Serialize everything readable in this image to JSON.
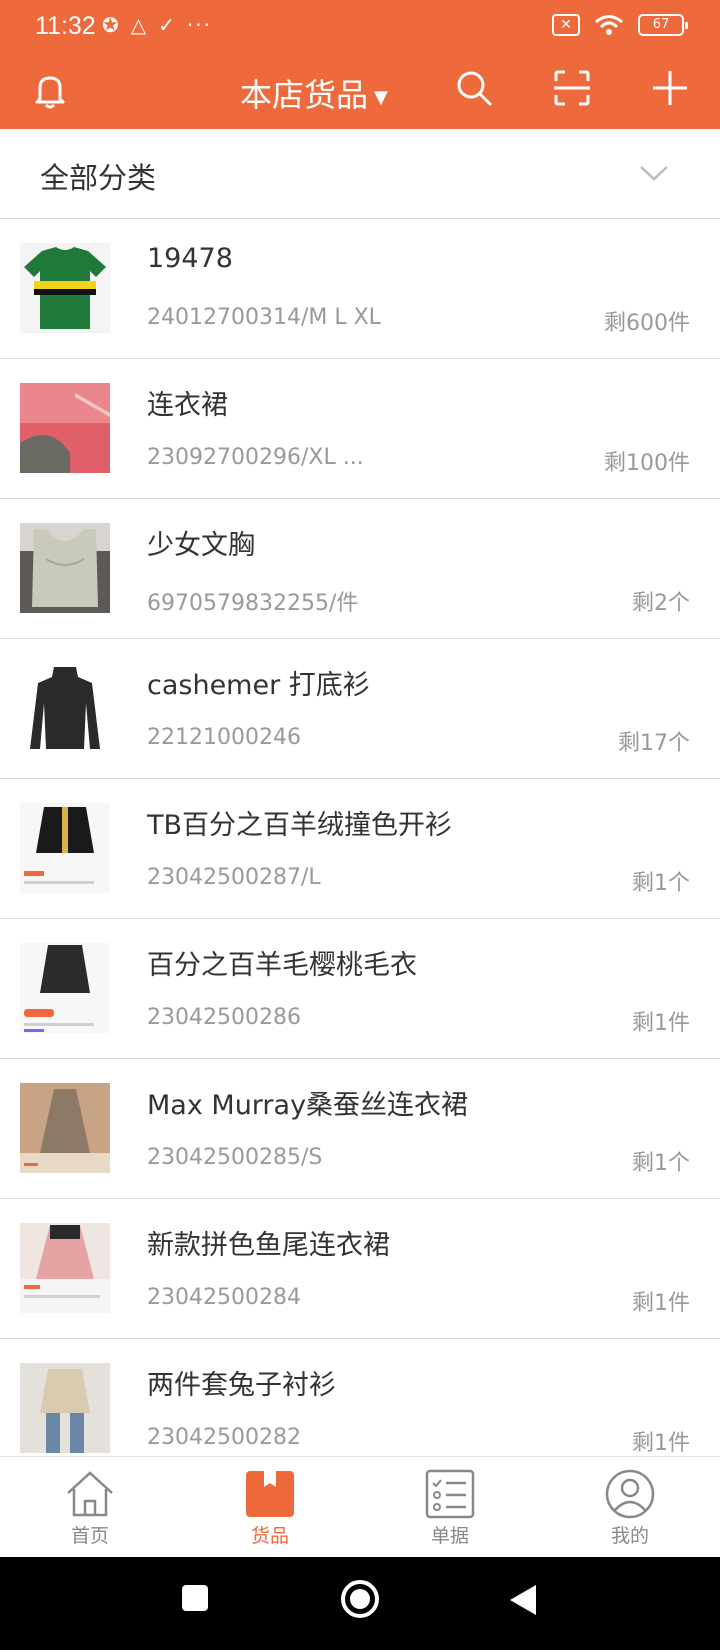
{
  "status_bar": {
    "time": "11:32",
    "battery": "67",
    "dots": "···"
  },
  "header": {
    "title": "本店货品",
    "caret": "▼",
    "icons": [
      "bell-icon",
      "search-icon",
      "scan-icon",
      "add-icon"
    ]
  },
  "category": {
    "label": "全部分类"
  },
  "products": [
    {
      "name": "19478",
      "code": "24012700314/M L XL",
      "stock": "剩600件"
    },
    {
      "name": "连衣裙",
      "code": "23092700296/XL  ...",
      "stock": "剩100件"
    },
    {
      "name": "少女文胸",
      "code": "6970579832255/件",
      "stock": "剩2个"
    },
    {
      "name": "cashemer 打底衫",
      "code": "22121000246",
      "stock": "剩17个"
    },
    {
      "name": "TB百分之百羊绒撞色开衫",
      "code": "23042500287/L",
      "stock": "剩1个"
    },
    {
      "name": "百分之百羊毛樱桃毛衣",
      "code": "23042500286",
      "stock": "剩1件"
    },
    {
      "name": "Max Murray桑蚕丝连衣裙",
      "code": "23042500285/S",
      "stock": "剩1个"
    },
    {
      "name": "新款拼色鱼尾连衣裙",
      "code": "23042500284",
      "stock": "剩1件"
    },
    {
      "name": "两件套兔子衬衫",
      "code": "23042500282",
      "stock": "剩1件"
    }
  ],
  "bottom_nav": [
    {
      "label": "首页",
      "icon": "home-icon",
      "active": false
    },
    {
      "label": "货品",
      "icon": "goods-box-icon",
      "active": true
    },
    {
      "label": "单据",
      "icon": "orders-list-icon",
      "active": false
    },
    {
      "label": "我的",
      "icon": "profile-icon",
      "active": false
    }
  ],
  "colors": {
    "accent": "#ee6a3d",
    "divider": "#dcdcdc",
    "secondary_text": "#999999"
  }
}
